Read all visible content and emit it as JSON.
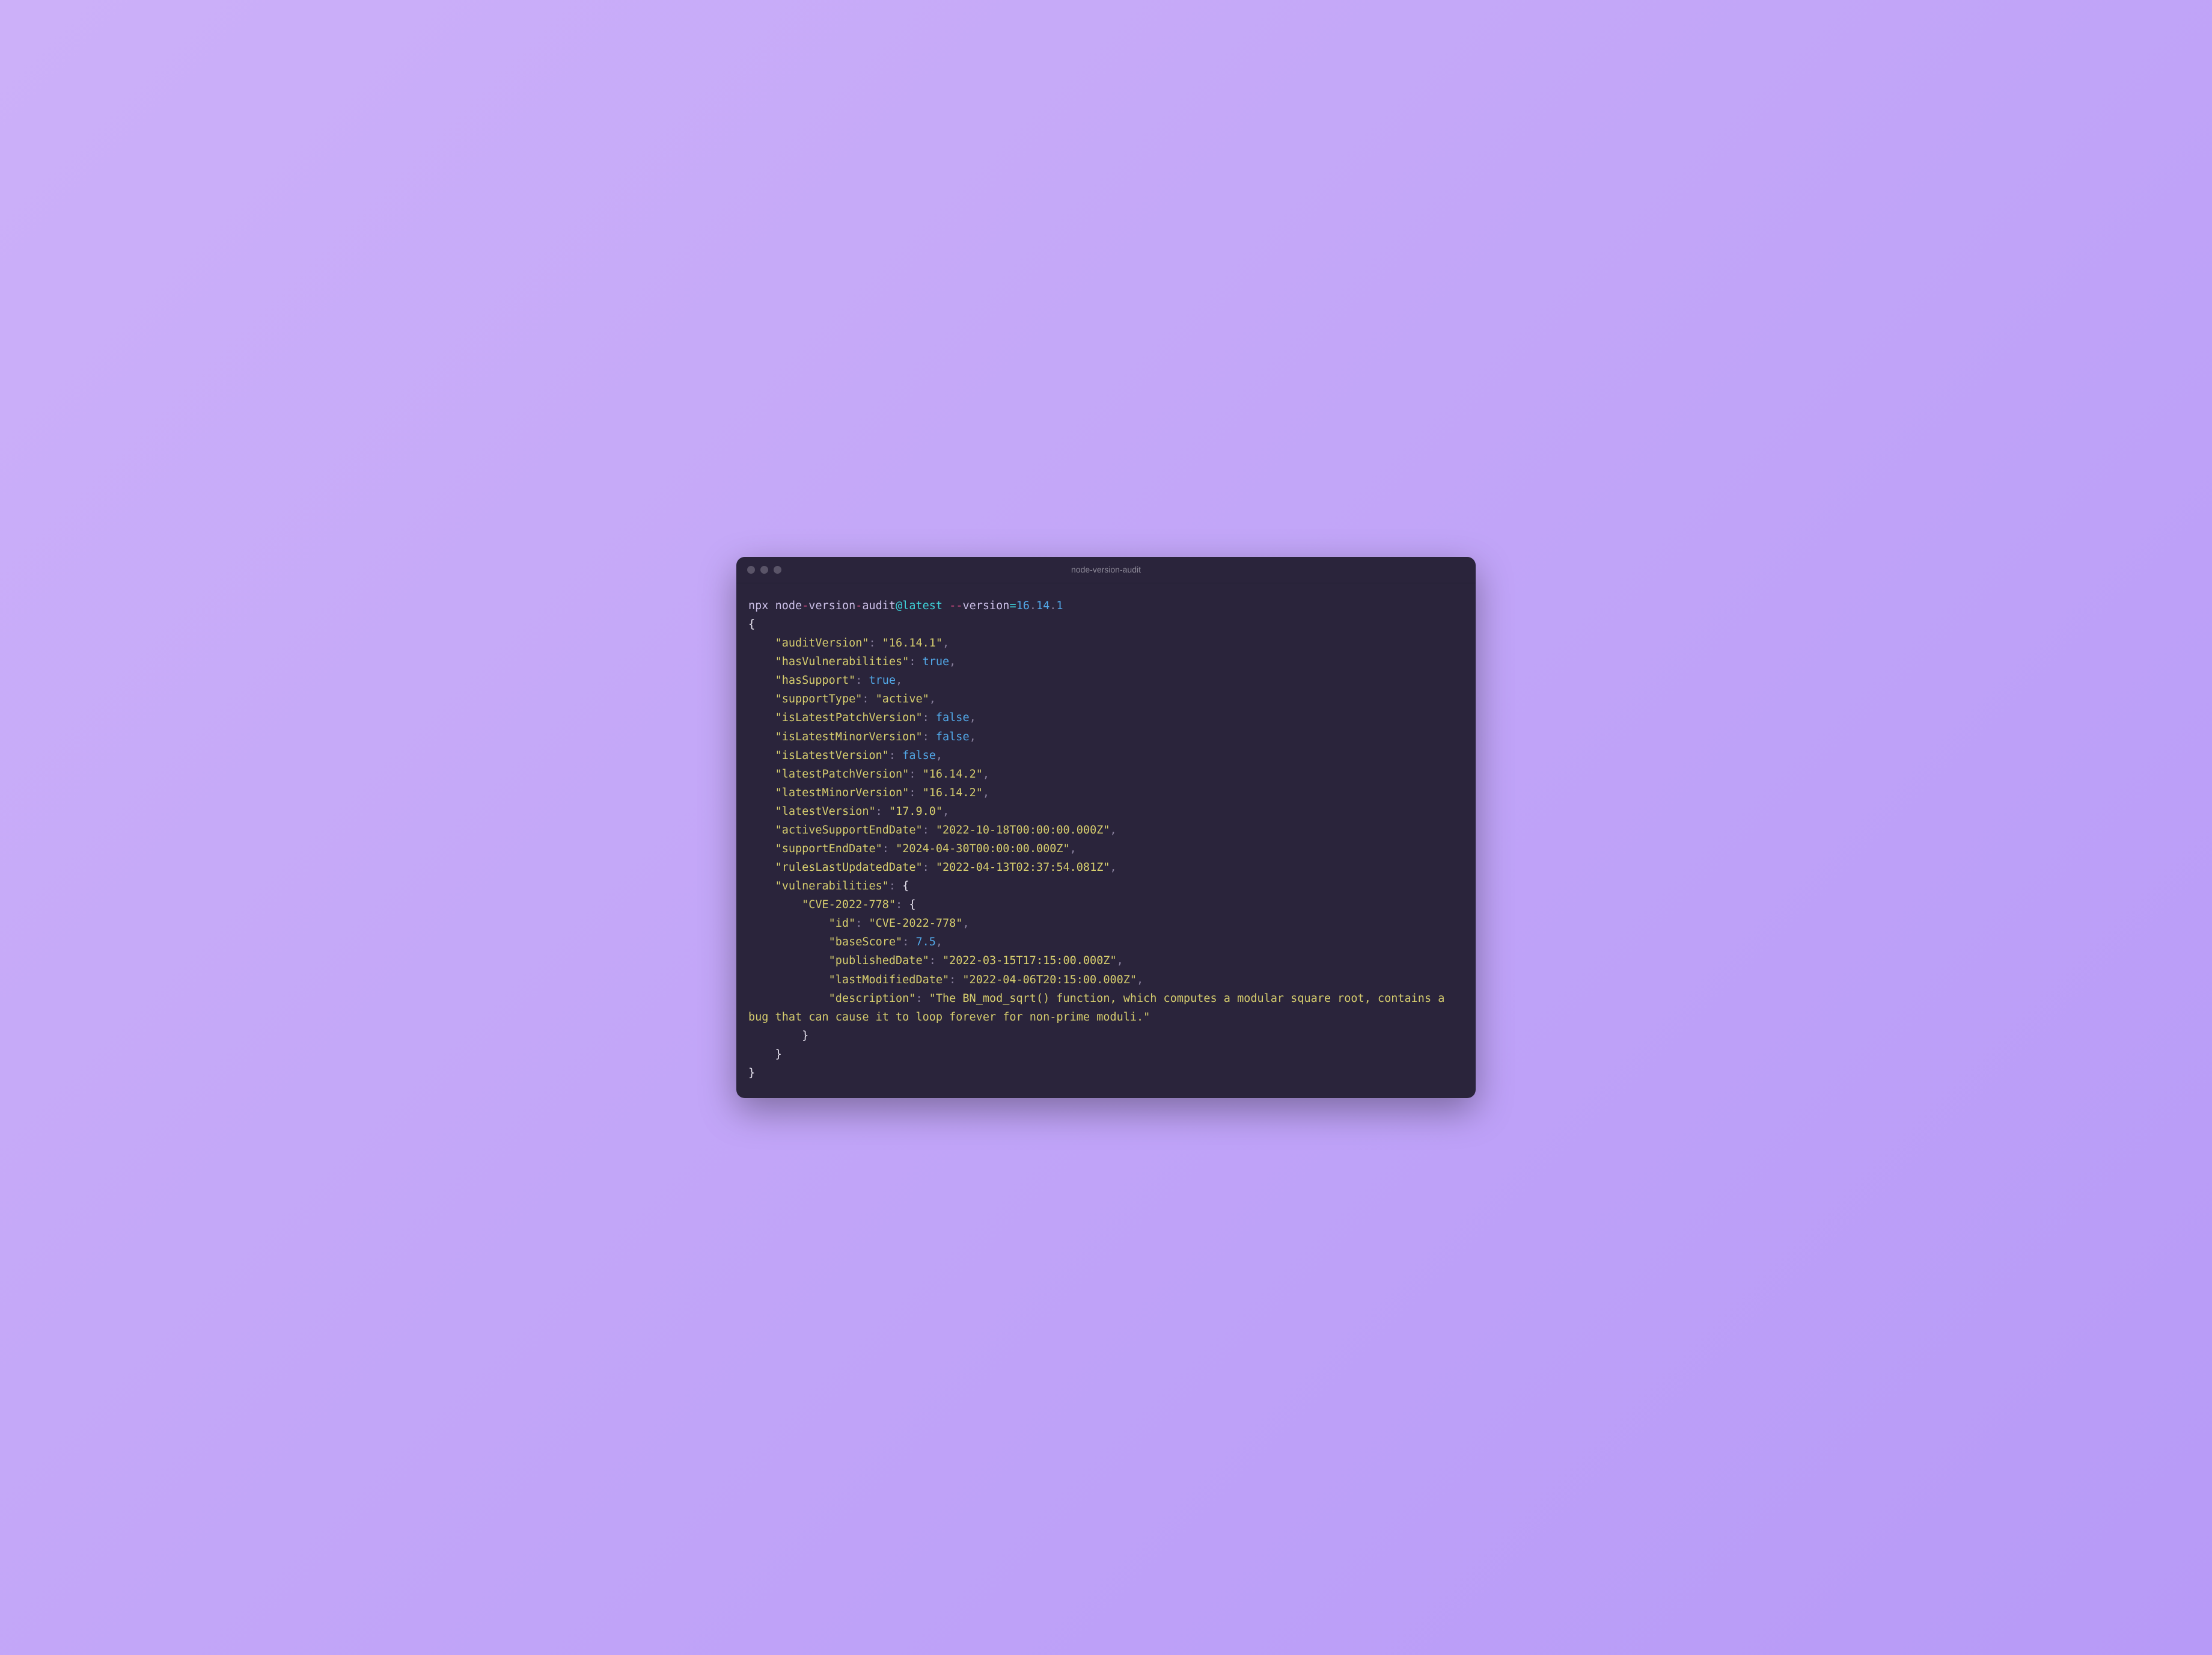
{
  "window": {
    "title": "node-version-audit"
  },
  "cmd": {
    "npx": "npx",
    "pkg1": "node",
    "pkg2": "version",
    "pkg3": "audit",
    "at": "@latest",
    "flag": "version",
    "eq": "=",
    "v1": "16",
    "v2": "14",
    "v3": "1"
  },
  "out": {
    "braceOpen": "{",
    "braceClose": "}",
    "innerBraceOpen": "{",
    "innerBraceClose": "}",
    "k_auditVersion": "\"auditVersion\"",
    "v_auditVersion": "\"16.14.1\"",
    "k_hasVuln": "\"hasVulnerabilities\"",
    "v_hasVuln": "true",
    "k_hasSupport": "\"hasSupport\"",
    "v_hasSupport": "true",
    "k_supportType": "\"supportType\"",
    "v_supportType": "\"active\"",
    "k_isLatestPatch": "\"isLatestPatchVersion\"",
    "v_isLatestPatch": "false",
    "k_isLatestMinor": "\"isLatestMinorVersion\"",
    "v_isLatestMinor": "false",
    "k_isLatest": "\"isLatestVersion\"",
    "v_isLatest": "false",
    "k_latestPatch": "\"latestPatchVersion\"",
    "v_latestPatch": "\"16.14.2\"",
    "k_latestMinor": "\"latestMinorVersion\"",
    "v_latestMinor": "\"16.14.2\"",
    "k_latestVersion": "\"latestVersion\"",
    "v_latestVersion": "\"17.9.0\"",
    "k_activeSupportEnd": "\"activeSupportEndDate\"",
    "v_activeSupportEnd": "\"2022-10-18T00:00:00.000Z\"",
    "k_supportEnd": "\"supportEndDate\"",
    "v_supportEnd": "\"2024-04-30T00:00:00.000Z\"",
    "k_rulesUpdated": "\"rulesLastUpdatedDate\"",
    "v_rulesUpdated": "\"2022-04-13T02:37:54.081Z\"",
    "k_vulns": "\"vulnerabilities\"",
    "k_cve": "\"CVE-2022-778\"",
    "k_id": "\"id\"",
    "v_id": "\"CVE-2022-778\"",
    "k_baseScore": "\"baseScore\"",
    "v_baseScore": "7.5",
    "k_published": "\"publishedDate\"",
    "v_published": "\"2022-03-15T17:15:00.000Z\"",
    "k_lastModified": "\"lastModifiedDate\"",
    "v_lastModified": "\"2022-04-06T20:15:00.000Z\"",
    "k_desc": "\"description\"",
    "v_desc": "\"The BN_mod_sqrt() function, which computes a modular square root, contains a bug that can cause it to loop forever for non-prime moduli.\""
  },
  "p": {
    "colon": ":",
    "comma": ",",
    "dot": ".",
    "dash": "-",
    "ddash": "--",
    "sp": " "
  }
}
